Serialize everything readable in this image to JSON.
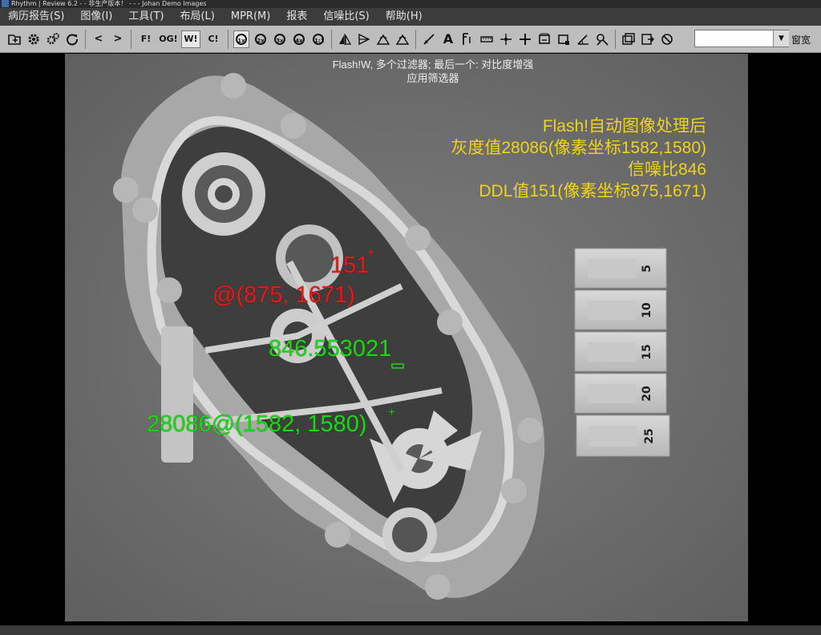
{
  "window": {
    "title": "Rhythm | Review 6.2 - - 非生产版本！ - - - Johan Demo Images"
  },
  "menu": {
    "items": [
      "病历报告(S)",
      "图像(I)",
      "工具(T)",
      "布局(L)",
      "MPR(M)",
      "报表",
      "信噪比(S)",
      "帮助(H)"
    ]
  },
  "toolbar": {
    "back_glyph": "<",
    "forward_glyph": ">",
    "filter_buttons": [
      "F!",
      "OG!",
      "W!",
      "C!"
    ],
    "zoom_buttons": [
      "1x",
      "2x",
      "3x",
      "4x",
      "1:1"
    ],
    "text_tool": "A",
    "search_value": "",
    "window_label": "窗宽"
  },
  "viewer": {
    "filter_caption_line1": "Flash!W, 多个过滤器; 最后一个: 对比度增强",
    "filter_caption_line2": "应用筛选器",
    "result_lines": [
      "Flash!自动图像处理后",
      "灰度值28086(像素坐标1582,1580)",
      "信噪比846",
      "DDL值151(像素坐标875,1671)"
    ],
    "ddl_value_label": "151",
    "ddl_coord_label": "@(875, 1671)",
    "snr_label": "846.553021",
    "gray_label": "28086@(1582, 1580)",
    "crosshair_glyph": "+",
    "step_wedge_labels": [
      "5",
      "10",
      "15",
      "20",
      "25"
    ]
  },
  "colors": {
    "result_text": "#f0d21e",
    "ddl_annotation": "#e21b1b",
    "snr_annotation": "#19d814",
    "xray_background": "#707070"
  }
}
